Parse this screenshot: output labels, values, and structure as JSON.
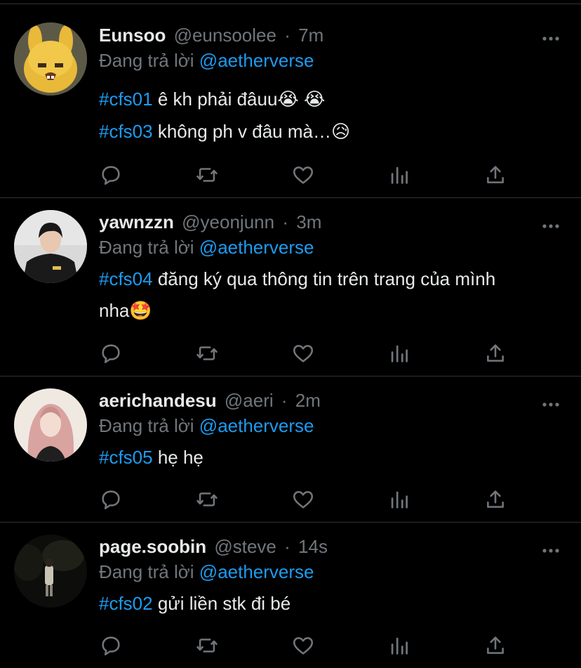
{
  "tweets": [
    {
      "name": "Eunsoo",
      "handle": "@eunsoolee",
      "sep": "·",
      "time": "7m",
      "reply_prefix": "Đang trả lời",
      "reply_to": "@aetherverse",
      "lines": [
        {
          "hashtag": "#cfs01",
          "text": " ê kh phải đâuu😭 😭"
        },
        {
          "hashtag": "#cfs03",
          "text": " không ph v đâu mà…😥"
        }
      ],
      "avatar": "yellow-cartoon-character"
    },
    {
      "name": "yawnzzn",
      "handle": "@yeonjunn",
      "sep": "·",
      "time": "3m",
      "reply_prefix": "Đang trả lời",
      "reply_to": "@aetherverse",
      "lines": [
        {
          "hashtag": "#cfs04",
          "text": " đăng ký qua thông tin trên trang của mình"
        },
        {
          "hashtag": "",
          "text": "nha🤩"
        }
      ],
      "avatar": "person-in-black-jacket"
    },
    {
      "name": "aerichandesu",
      "handle": "@aeri",
      "sep": "·",
      "time": "2m",
      "reply_prefix": "Đang trả lời",
      "reply_to": "@aetherverse",
      "lines": [
        {
          "hashtag": "#cfs05",
          "text": " hẹ hẹ"
        }
      ],
      "avatar": "girl-with-pink-hair"
    },
    {
      "name": "page.soobin",
      "handle": "@steve",
      "sep": "·",
      "time": "14s",
      "reply_prefix": "Đang trả lời",
      "reply_to": "@aetherverse",
      "lines": [
        {
          "hashtag": "#cfs02",
          "text": " gửi liền stk đi bé"
        }
      ],
      "avatar": "person-standing-at-night"
    }
  ],
  "icons": [
    "reply-icon",
    "retweet-icon",
    "like-icon",
    "analytics-icon",
    "share-icon",
    "more-icon"
  ],
  "colors": {
    "background": "#000000",
    "text": "#e7e9ea",
    "muted": "#71767b",
    "accent": "#1d9bf0",
    "divider": "#2f3336"
  }
}
